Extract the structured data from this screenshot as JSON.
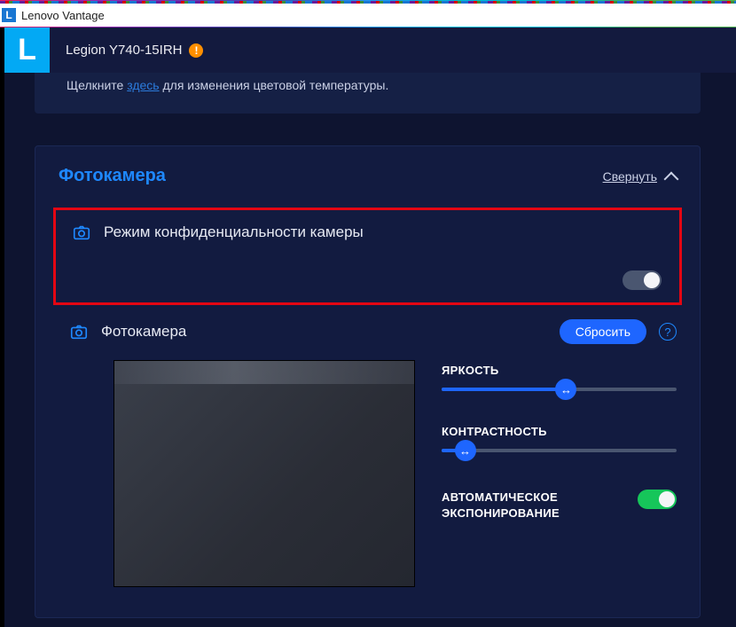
{
  "titlebar": {
    "app_name": "Lenovo Vantage"
  },
  "header": {
    "device_name": "Legion Y740-15IRH"
  },
  "hint": {
    "prefix": "Щелкните",
    "link": "здесь",
    "suffix": "для изменения цветовой температуры."
  },
  "camera_panel": {
    "title": "Фотокамера",
    "collapse_label": "Свернуть",
    "privacy_row_label": "Режим конфиденциальности камеры",
    "privacy_toggle_on": false,
    "camera_row_label": "Фотокамера",
    "reset_label": "Сбросить",
    "controls": {
      "brightness": {
        "label": "ЯРКОСТЬ",
        "value": 53
      },
      "contrast": {
        "label": "КОНТРАСТНОСТЬ",
        "value": 10
      },
      "auto_exposure": {
        "label": "АВТОМАТИЧЕСКОЕ ЭКСПОНИРОВАНИЕ",
        "on": true
      }
    }
  }
}
